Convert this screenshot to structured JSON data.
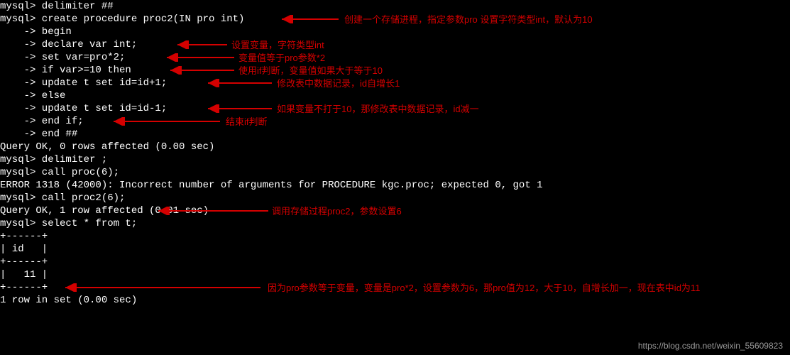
{
  "lines": {
    "l0": "mysql> delimiter ##",
    "l1": "mysql> create procedure proc2(IN pro int)",
    "l2": "    -> begin",
    "l3": "    -> declare var int;",
    "l4": "    -> set var=pro*2;",
    "l5": "    -> if var>=10 then",
    "l6": "    -> update t set id=id+1;",
    "l7": "    -> else",
    "l8": "    -> update t set id=id-1;",
    "l9": "    -> end if;",
    "l10": "    -> end ##",
    "l11": "Query OK, 0 rows affected (0.00 sec)",
    "l12": "",
    "l13": "mysql> delimiter ;",
    "l14": "mysql> call proc(6);",
    "l15": "ERROR 1318 (42000): Incorrect number of arguments for PROCEDURE kgc.proc; expected 0, got 1",
    "l16": "mysql> call proc2(6);",
    "l17": "Query OK, 1 row affected (0.01 sec)",
    "l18": "",
    "l19": "mysql> select * from t;",
    "l20": "+------+",
    "l21": "| id   |",
    "l22": "+------+",
    "l23": "|   11 |",
    "l24": "+------+",
    "l25": "1 row in set (0.00 sec)"
  },
  "annotations": {
    "a1": "创建一个存储进程，指定参数pro 设置字符类型int，默认为10",
    "a2": "设置变量，字符类型int",
    "a3": "变量值等于pro参数*2",
    "a4": "使用if判断，变量值如果大于等于10",
    "a5": "修改表中数据记录，id自增长1",
    "a6": "如果变量不打于10，那修改表中数据记录，id减一",
    "a7": "结束if判断",
    "a8": "调用存储过程proc2，参数设置6",
    "a9": "因为pro参数等于变量，变量是pro*2，设置参数为6，那pro值为12，大于10，自增长加一，现在表中id为11"
  },
  "watermark": "https://blog.csdn.net/weixin_55609823"
}
